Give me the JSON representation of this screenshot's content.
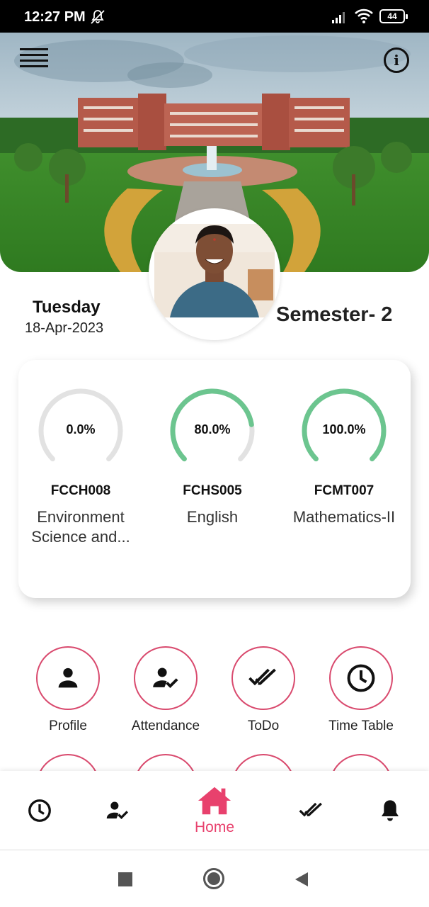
{
  "status_bar": {
    "time": "12:27 PM",
    "battery": "44"
  },
  "header": {
    "menu_icon": "hamburger-menu-icon",
    "info_icon": "info-icon"
  },
  "profile": {
    "day": "Tuesday",
    "date": "18-Apr-2023",
    "semester": "Semester- 2"
  },
  "subjects": [
    {
      "code": "FCCH008",
      "name": "Environment Science and...",
      "percent_label": "0.0%",
      "percent": 0.0
    },
    {
      "code": "FCHS005",
      "name": "English",
      "percent_label": "80.0%",
      "percent": 80.0
    },
    {
      "code": "FCMT007",
      "name": "Mathematics-II",
      "percent_label": "100.0%",
      "percent": 100.0
    }
  ],
  "features": [
    {
      "label": "Profile",
      "icon": "person-icon"
    },
    {
      "label": "Attendance",
      "icon": "person-check-icon"
    },
    {
      "label": "ToDo",
      "icon": "double-check-icon"
    },
    {
      "label": "Time Table",
      "icon": "clock-icon"
    }
  ],
  "bottom_nav": {
    "items": [
      {
        "icon": "clock-icon"
      },
      {
        "icon": "person-check-icon"
      },
      {
        "icon": "home-icon",
        "label": "Home",
        "active": true
      },
      {
        "icon": "double-check-icon"
      },
      {
        "icon": "bell-icon"
      }
    ]
  },
  "colors": {
    "accent": "#e8416d",
    "gauge_fill": "#6cc58f",
    "gauge_track": "#e2e2e2",
    "ring": "#d94a6e"
  }
}
